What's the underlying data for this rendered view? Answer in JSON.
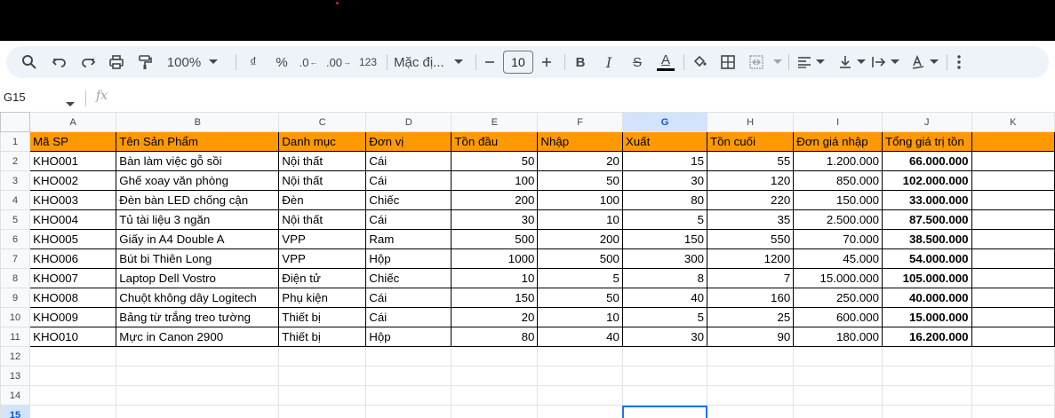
{
  "toolbar": {
    "zoom": "100%",
    "currency": "₫",
    "percent": "%",
    "dec_decrease": ".0",
    "dec_increase": ".00",
    "number_format": "123",
    "font_name": "Mặc đị...",
    "font_size": "10",
    "bold": "B",
    "italic": "I",
    "strike": "S",
    "text_color": "A",
    "text_color_swatch": "#000000"
  },
  "formula_bar": {
    "cell_ref": "G15",
    "fx": "fx"
  },
  "sheet": {
    "columns": [
      "A",
      "B",
      "C",
      "D",
      "E",
      "F",
      "G",
      "H",
      "I",
      "J",
      "K"
    ],
    "selected_column": "G",
    "selected_row": "15",
    "header_fill": "#ff9900",
    "header_row": [
      "Mã SP",
      "Tên Sản Phẩm",
      "Danh mục",
      "Đơn vị",
      "Tồn đầu",
      "Nhập",
      "Xuất",
      "Tồn cuối",
      "Đơn giá nhập",
      "Tổng giá trị tồn"
    ],
    "rows": [
      [
        "KHO001",
        "Bàn làm việc gỗ sồi",
        "Nội thất",
        "Cái",
        "50",
        "20",
        "15",
        "55",
        "1.200.000",
        "66.000.000"
      ],
      [
        "KHO002",
        "Ghế xoay văn phòng",
        "Nội thất",
        "Cái",
        "100",
        "50",
        "30",
        "120",
        "850.000",
        "102.000.000"
      ],
      [
        "KHO003",
        "Đèn bàn LED chống cận",
        "Đèn",
        "Chiếc",
        "200",
        "100",
        "80",
        "220",
        "150.000",
        "33.000.000"
      ],
      [
        "KHO004",
        "Tủ tài liệu 3 ngăn",
        "Nội thất",
        "Cái",
        "30",
        "10",
        "5",
        "35",
        "2.500.000",
        "87.500.000"
      ],
      [
        "KHO005",
        "Giấy in A4 Double A",
        "VPP",
        "Ram",
        "500",
        "200",
        "150",
        "550",
        "70.000",
        "38.500.000"
      ],
      [
        "KHO006",
        "Bút bi Thiên Long",
        "VPP",
        "Hộp",
        "1000",
        "500",
        "300",
        "1200",
        "45.000",
        "54.000.000"
      ],
      [
        "KHO007",
        "Laptop Dell Vostro",
        "Điện tử",
        "Chiếc",
        "10",
        "5",
        "8",
        "7",
        "15.000.000",
        "105.000.000"
      ],
      [
        "KHO008",
        "Chuột không dây Logitech",
        "Phụ kiện",
        "Cái",
        "150",
        "50",
        "40",
        "160",
        "250.000",
        "40.000.000"
      ],
      [
        "KHO009",
        "Bảng từ trắng treo tường",
        "Thiết bị",
        "Cái",
        "20",
        "10",
        "5",
        "25",
        "600.000",
        "15.000.000"
      ],
      [
        "KHO010",
        "Mực in Canon 2900",
        "Thiết bị",
        "Hộp",
        "80",
        "40",
        "30",
        "90",
        "180.000",
        "16.200.000"
      ]
    ],
    "row_numbers": [
      "1",
      "2",
      "3",
      "4",
      "5",
      "6",
      "7",
      "8",
      "9",
      "10",
      "11",
      "12",
      "13",
      "14",
      "15"
    ]
  }
}
